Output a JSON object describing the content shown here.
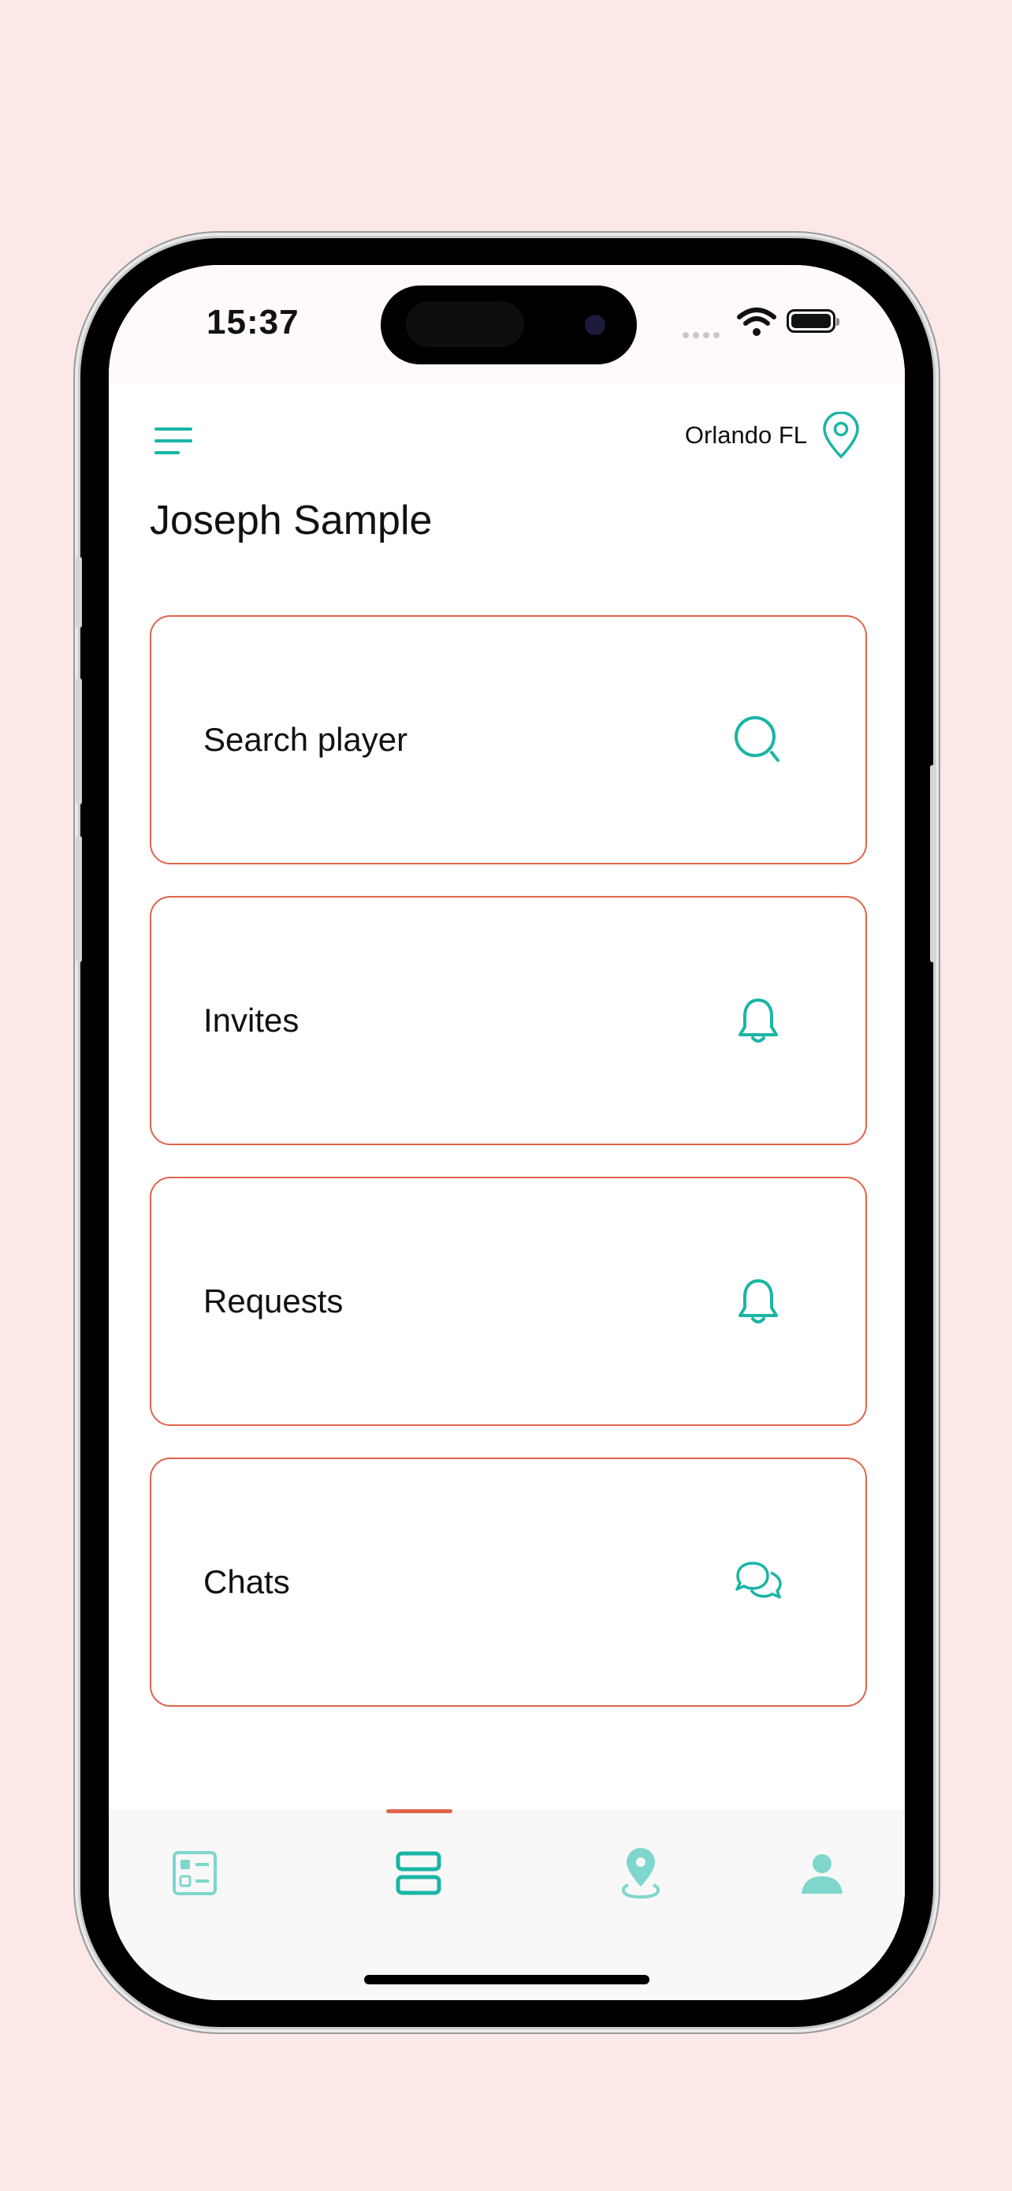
{
  "status_bar": {
    "time": "15:37"
  },
  "header": {
    "location_label": "Orlando FL",
    "user_name": "Joseph Sample"
  },
  "menu_cards": [
    {
      "label": "Search player",
      "icon": "search-icon"
    },
    {
      "label": "Invites",
      "icon": "bell-icon"
    },
    {
      "label": "Requests",
      "icon": "bell-icon"
    },
    {
      "label": "Chats",
      "icon": "chat-bubbles-icon"
    }
  ],
  "tab_bar": {
    "tabs": [
      {
        "icon": "checklist-icon",
        "active": false
      },
      {
        "icon": "rows-icon",
        "active": true
      },
      {
        "icon": "map-pin-icon",
        "active": false
      },
      {
        "icon": "profile-icon",
        "active": false
      }
    ]
  },
  "colors": {
    "accent": "#1ab5a5",
    "card_border": "#e0644b",
    "background": "#fde8e8"
  }
}
